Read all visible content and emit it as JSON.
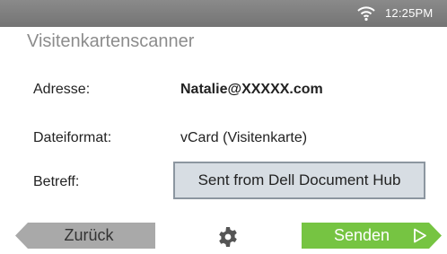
{
  "status_bar": {
    "time": "12:25PM",
    "wifi_icon": "wifi-icon"
  },
  "app": {
    "title": "Visitenkartenscanner"
  },
  "fields": {
    "address_label": "Adresse:",
    "address_value": "Natalie@XXXXX.com",
    "format_label": "Dateiformat:",
    "format_value": "vCard (Visitenkarte)",
    "subject_label": "Betreff:",
    "subject_value": "Sent from Dell Document Hub"
  },
  "footer": {
    "back_label": "Zurück",
    "settings_icon": "gear-icon",
    "send_label": "Senden",
    "send_icon": "play-arrow-icon"
  },
  "colors": {
    "status_bar": "#7f7f7f",
    "send_button": "#76c442",
    "back_button": "#a9a9a9",
    "subject_field": "#d7dde3"
  }
}
